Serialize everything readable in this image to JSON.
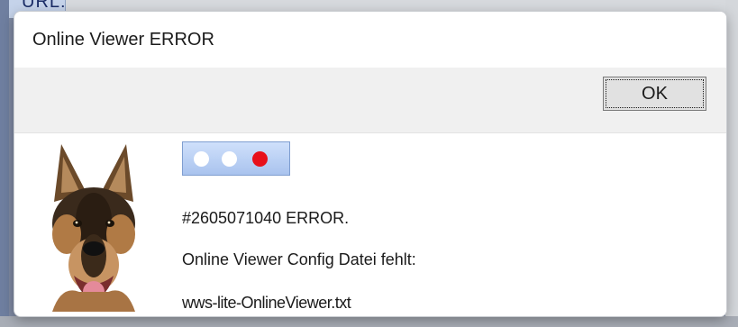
{
  "background": {
    "url_label": "URL:"
  },
  "dialog": {
    "title": "Online Viewer ERROR",
    "ok_label": "OK",
    "status_dots": [
      {
        "color": "#ffffff"
      },
      {
        "color": "#ffffff"
      },
      {
        "color": "#e8101a"
      }
    ],
    "messages": [
      "#2605071040 ERROR.",
      "Online Viewer Config Datei fehlt:",
      "wws-lite-OnlineViewer.txt"
    ]
  }
}
